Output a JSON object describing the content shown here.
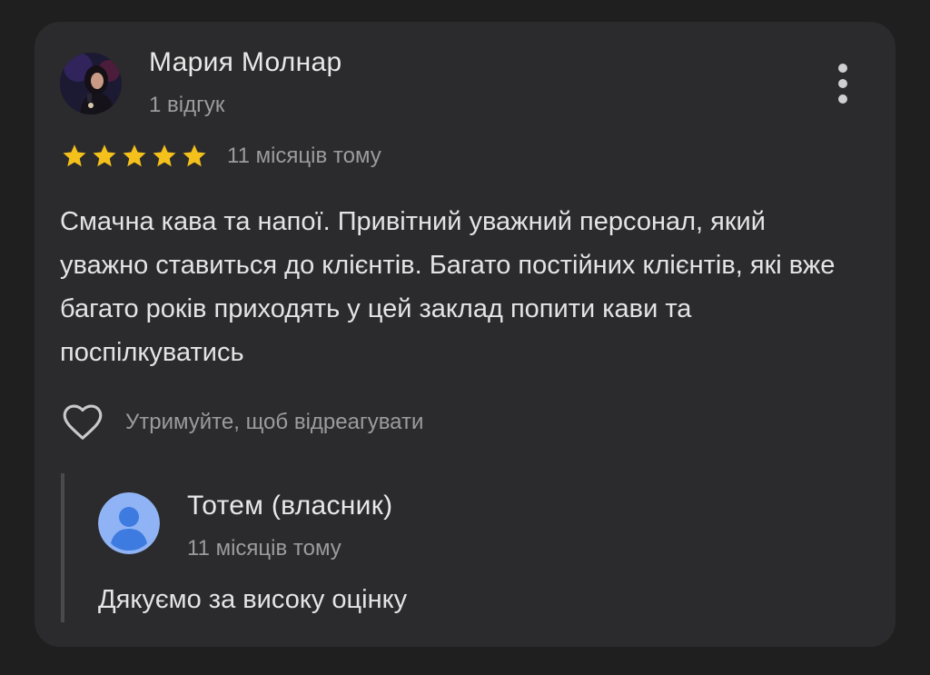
{
  "review": {
    "author": {
      "name": "Мария Молнар",
      "meta": "1 відгук",
      "avatar_icon": "user-photo"
    },
    "rating": 5,
    "rating_max": 5,
    "star_color": "#f4c01b",
    "time": "11 місяців тому",
    "text": "Смачна кава та напої. Привітний уважний персонал, який уважно ставиться до клієнтів. Багато постійних клієнтів, які вже багато років приходять у цей заклад попити кави та поспілкуватись",
    "react_hint": "Утримуйте, щоб відреагувати",
    "more_icon": "more-vertical-icon",
    "react_icon": "heart-outline-icon"
  },
  "owner_reply": {
    "name": "Тотем (власник)",
    "time": "11 місяців тому",
    "text": "Дякуємо за високу оцінку",
    "avatar_icon": "default-person-icon",
    "avatar_color": "#8fb3f4"
  }
}
